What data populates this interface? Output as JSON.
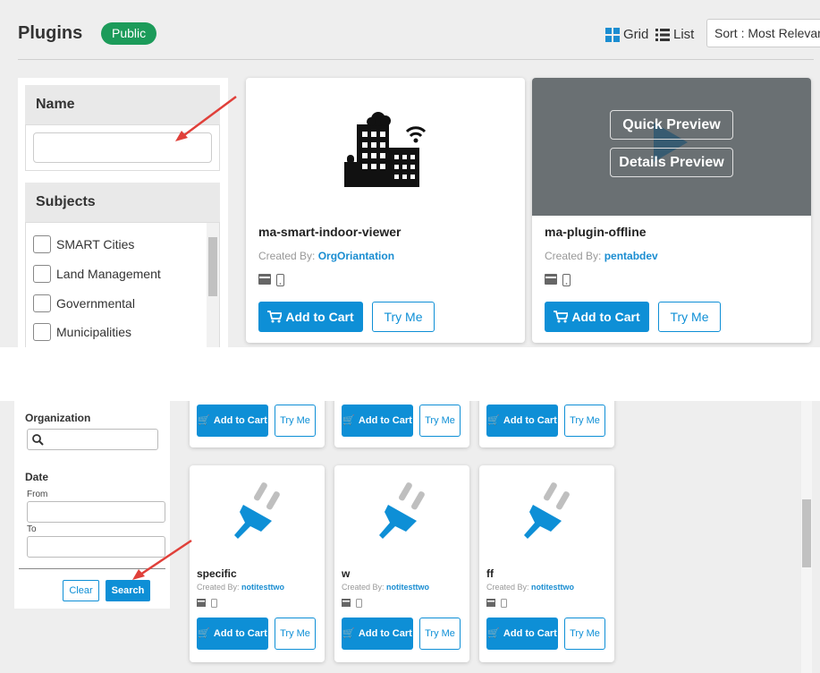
{
  "header": {
    "title": "Plugins",
    "badge": "Public",
    "grid_label": "Grid",
    "list_label": "List",
    "sort_label": "Sort : Most Relevant"
  },
  "filters": {
    "name_heading": "Name",
    "subjects_heading": "Subjects",
    "subjects": [
      "SMART Cities",
      "Land Management",
      "Governmental",
      "Municipalities"
    ]
  },
  "cards_top": [
    {
      "title": "ma-smart-indoor-viewer",
      "created_by_label": "Created By:",
      "author": "OrgOriantation",
      "add_label": "Add to Cart",
      "try_label": "Try Me"
    },
    {
      "title": "ma-plugin-offline",
      "created_by_label": "Created By:",
      "author": "pentabdev",
      "add_label": "Add to Cart",
      "try_label": "Try Me",
      "quick_preview": "Quick Preview",
      "details_preview": "Details Preview"
    }
  ],
  "bottom_filters": {
    "organization_label": "Organization",
    "date_label": "Date",
    "from_label": "From",
    "to_label": "To",
    "clear_label": "Clear",
    "search_label": "Search"
  },
  "cards_bottom_row1": [
    {
      "add_label": "Add to Cart",
      "try_label": "Try Me"
    },
    {
      "add_label": "Add to Cart",
      "try_label": "Try Me"
    },
    {
      "add_label": "Add to Cart",
      "try_label": "Try Me"
    }
  ],
  "cards_bottom_row2": [
    {
      "title": "specific",
      "created_by_label": "Created By:",
      "author": "notitesttwo",
      "add_label": "Add to Cart",
      "try_label": "Try Me"
    },
    {
      "title": "w",
      "created_by_label": "Created By:",
      "author": "notitesttwo",
      "add_label": "Add to Cart",
      "try_label": "Try Me"
    },
    {
      "title": "ff",
      "created_by_label": "Created By:",
      "author": "notitesttwo",
      "add_label": "Add to Cart",
      "try_label": "Try Me"
    }
  ],
  "colors": {
    "accent": "#0e8fd6",
    "badge": "#1c9b5a",
    "annotation_arrow": "#e0403a"
  },
  "icons": [
    "grid-icon",
    "list-icon",
    "cart-icon",
    "building-icon",
    "plug-icon",
    "desktop-icon",
    "mobile-icon",
    "search-icon"
  ]
}
